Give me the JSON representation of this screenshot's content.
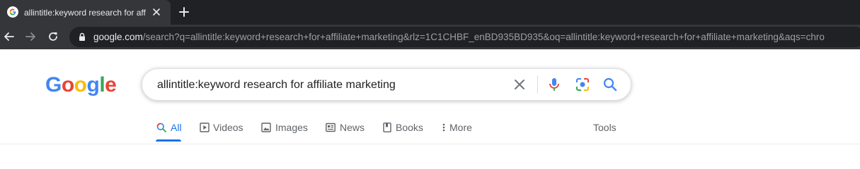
{
  "browser": {
    "tab": {
      "title": "allintitle:keyword research for affiliate marketing"
    },
    "address": {
      "host": "google.com",
      "path": "/search?q=allintitle:keyword+research+for+affiliate+marketing&rlz=1C1CHBF_enBD935BD935&oq=allintitle:keyword+research+for+affiliate+marketing&aqs=chro"
    }
  },
  "logo": {
    "letters": [
      "G",
      "o",
      "o",
      "g",
      "l",
      "e"
    ],
    "colors": [
      "#4285f4",
      "#ea4335",
      "#fbbc05",
      "#4285f4",
      "#34a853",
      "#ea4335"
    ]
  },
  "search": {
    "query": "allintitle:keyword research for affiliate marketing"
  },
  "nav": {
    "tabs": [
      {
        "label": "All",
        "icon": "search-icon",
        "active": true
      },
      {
        "label": "Videos",
        "icon": "video-icon"
      },
      {
        "label": "Images",
        "icon": "image-icon"
      },
      {
        "label": "News",
        "icon": "news-icon"
      },
      {
        "label": "Books",
        "icon": "book-icon"
      },
      {
        "label": "More",
        "icon": "more-vert-icon"
      }
    ],
    "tools_label": "Tools"
  },
  "colors": {
    "accent": "#1a73e8",
    "chrome_dark": "#202124",
    "chrome_toolbar": "#35363a"
  }
}
